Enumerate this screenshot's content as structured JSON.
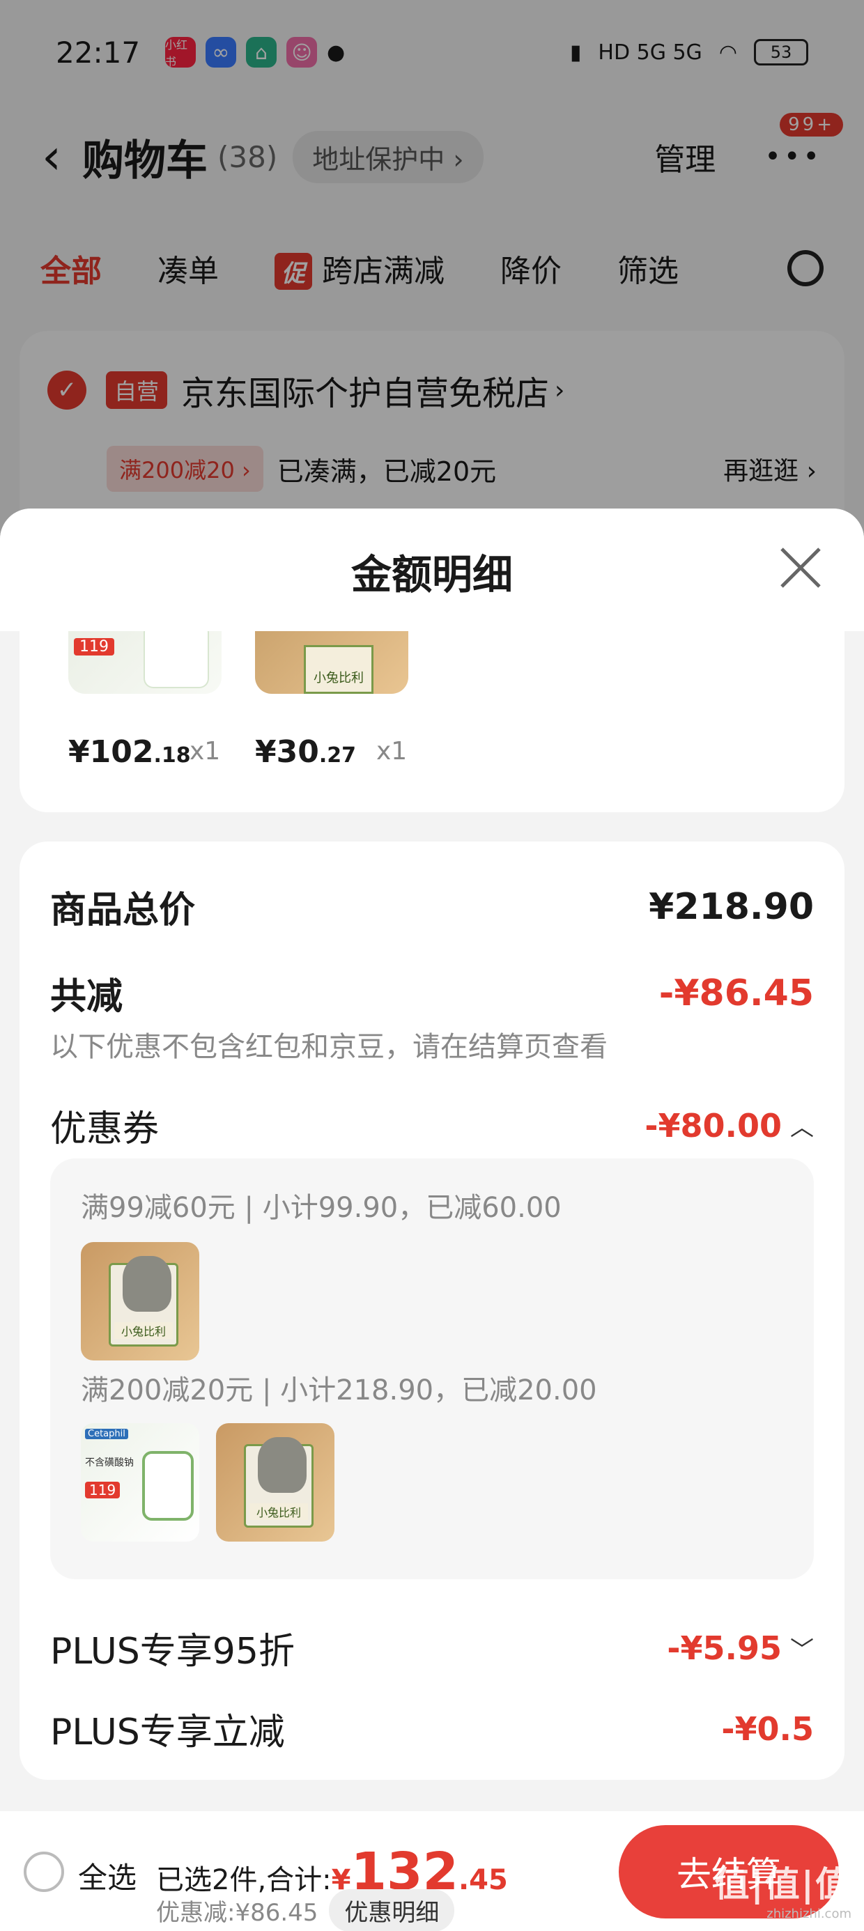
{
  "status_bar": {
    "time": "22:17",
    "app_icons": [
      {
        "name": "xiaohongshu-icon",
        "label": "小红书",
        "color": "#ff2442"
      },
      {
        "name": "infinity-app-icon",
        "label": "∞",
        "color": "#3a7bff"
      },
      {
        "name": "mijia-icon",
        "label": "⌂",
        "color": "#2bb38a"
      },
      {
        "name": "avatar-app-icon",
        "label": "☺",
        "color": "#f06ea9"
      }
    ],
    "network": "HD 5G 5G",
    "battery": "53"
  },
  "nav": {
    "title": "购物车",
    "count": "(38)",
    "address_protection": "地址保护中",
    "manage": "管理",
    "badge": "99+"
  },
  "tabs": [
    {
      "label": "全部",
      "active": true
    },
    {
      "label": "凑单",
      "active": false
    },
    {
      "label": "跨店满减",
      "active": false,
      "promo_mark": "促"
    },
    {
      "label": "降价",
      "active": false
    },
    {
      "label": "筛选",
      "active": false
    }
  ],
  "store": {
    "tag": "自营",
    "name": "京东国际个护自营免税店",
    "coupon_tag": "满200减20",
    "coupon_status": "已凑满，已减20元",
    "browse_more": "再逛逛"
  },
  "sheet": {
    "title": "金额明细",
    "products": [
      {
        "price_int": "¥102",
        "price_dec": ".18",
        "qty": "x1",
        "thumb_price": "119"
      },
      {
        "price_int": "¥30",
        "price_dec": ".27",
        "qty": "x1",
        "thumb_label": "小兔比利"
      }
    ],
    "total_label": "商品总价",
    "total_value": "¥218.90",
    "discount_label": "共减",
    "discount_value": "-¥86.45",
    "discount_note": "以下优惠不包含红包和京豆，请在结算页查看",
    "coupon_label": "优惠券",
    "coupon_value": "-¥80.00",
    "coupon_groups": [
      {
        "desc": "满99减60元 | 小计99.90，已减60.00"
      },
      {
        "desc": "满200减20元 | 小计218.90，已减20.00"
      }
    ],
    "thumbs": {
      "bunny_label": "小兔比利",
      "cetaphil_brand": "Cetaphil",
      "cetaphil_text": "不含磺酸钠",
      "cetaphil_price": "119"
    },
    "plus95_label": "PLUS专享95折",
    "plus95_value": "-¥5.95",
    "plus_direct_label": "PLUS专享立减",
    "plus_direct_value": "-¥0.5"
  },
  "bottom": {
    "select_all": "全选",
    "selected_text": "已选2件,合计:",
    "total_currency": "¥",
    "total_int": "132",
    "total_dec": ".45",
    "discount_text": "优惠减:¥86.45",
    "detail_chip": "优惠明细",
    "checkout": "去结算"
  },
  "watermark": {
    "big": "值|值|值",
    "small": "zhizhizhi.com"
  },
  "colors": {
    "accent": "#e23a2e",
    "checkout": "#e8403a"
  }
}
